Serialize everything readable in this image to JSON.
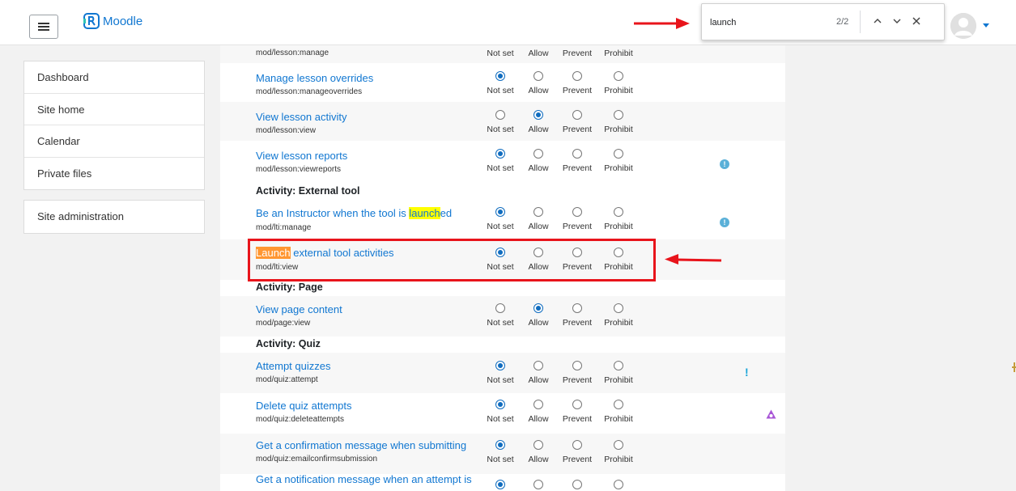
{
  "app": {
    "brand": "Moodle"
  },
  "findbar": {
    "query": "launch",
    "count": "2/2"
  },
  "sidebar": {
    "items": [
      "Dashboard",
      "Site home",
      "Calendar",
      "Private files"
    ],
    "admin": "Site administration"
  },
  "permission_labels": [
    "Not set",
    "Allow",
    "Prevent",
    "Prohibit"
  ],
  "rows": {
    "r0": {
      "name": "mod/lesson:manage"
    },
    "r1": {
      "title": "Manage lesson overrides",
      "name": "mod/lesson:manageoverrides"
    },
    "r2": {
      "title": "View lesson activity",
      "name": "mod/lesson:view"
    },
    "r3": {
      "title": "View lesson reports",
      "name": "mod/lesson:viewreports"
    },
    "s1": {
      "title": "Activity: External tool"
    },
    "r4": {
      "title_pre": "Be an Instructor when the tool is ",
      "title_match": "launch",
      "title_post": "ed",
      "name": "mod/lti:manage"
    },
    "r5": {
      "title_match": "Launch",
      "title_post": " external tool activities",
      "name": "mod/lti:view"
    },
    "s2": {
      "title": "Activity: Page"
    },
    "r6": {
      "title": "View page content",
      "name": "mod/page:view"
    },
    "s3": {
      "title": "Activity: Quiz"
    },
    "r7": {
      "title": "Attempt quizzes",
      "name": "mod/quiz:attempt"
    },
    "r8": {
      "title": "Delete quiz attempts",
      "name": "mod/quiz:deleteattempts"
    },
    "r9": {
      "title": "Get a confirmation message when submitting",
      "name": "mod/quiz:emailconfirmsubmission"
    },
    "r10": {
      "title": "Get a notification message when an attempt is"
    }
  },
  "selected_permission": {
    "r1": "Not set",
    "r2": "Allow",
    "r3": "Not set",
    "r4": "Not set",
    "r5": "Not set",
    "r6": "Allow",
    "r7": "Not set",
    "r8": "Not set",
    "r9": "Not set",
    "r10": "Not set"
  },
  "colors": {
    "link": "#1177d1",
    "radio": "#0f6cbf",
    "match_highlight": "#ffff00",
    "active_match_highlight": "#ff9632",
    "annotation_red": "#e8141b"
  }
}
